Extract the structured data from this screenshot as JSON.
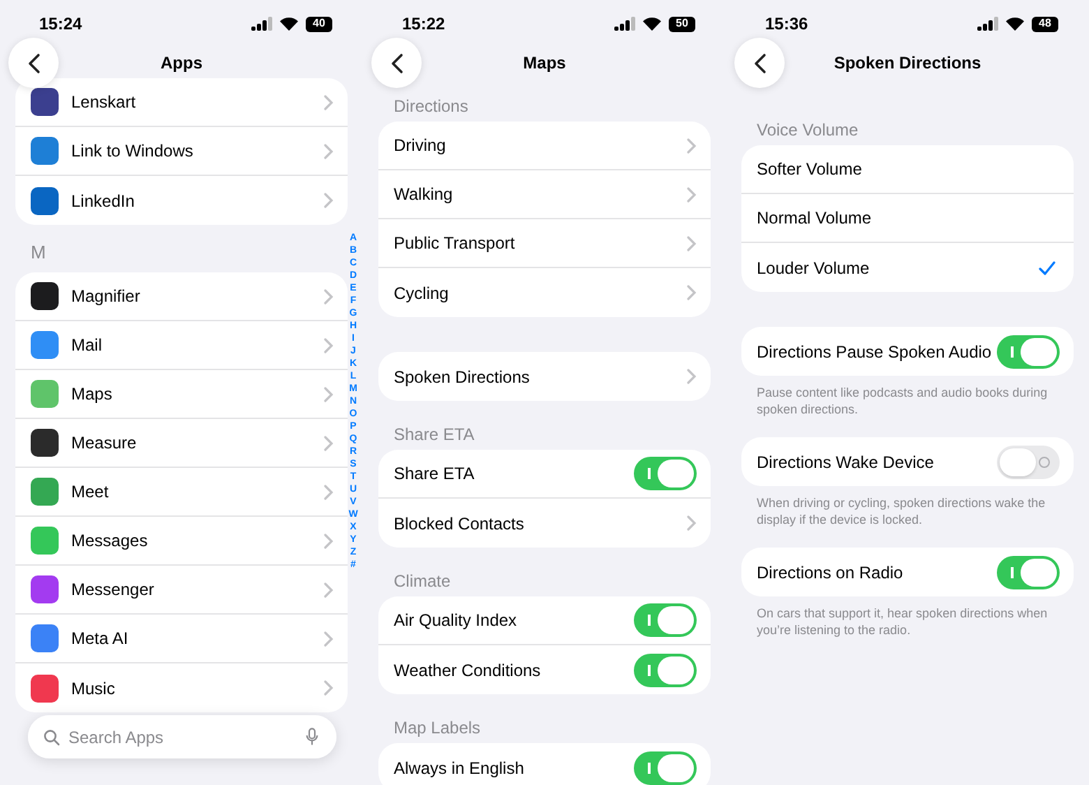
{
  "screens": [
    {
      "kind": "apps",
      "status": {
        "time": "15:24",
        "battery": "40"
      },
      "title": "Apps",
      "sections": [
        {
          "rows": [
            {
              "kind": "link",
              "label": "Lenskart",
              "color": "#3b3f8f"
            },
            {
              "kind": "link",
              "label": "Link to Windows",
              "color": "#1e7fd6"
            },
            {
              "kind": "link",
              "label": "LinkedIn",
              "color": "#0a66c2"
            }
          ]
        },
        {
          "header": "M",
          "rows": [
            {
              "kind": "link",
              "label": "Magnifier",
              "color": "#1c1c1e"
            },
            {
              "kind": "link",
              "label": "Mail",
              "color": "#2f8ef5"
            },
            {
              "kind": "link",
              "label": "Maps",
              "color": "#5fc46a"
            },
            {
              "kind": "link",
              "label": "Measure",
              "color": "#2b2b2b"
            },
            {
              "kind": "link",
              "label": "Meet",
              "color": "#34a853"
            },
            {
              "kind": "link",
              "label": "Messages",
              "color": "#34c759"
            },
            {
              "kind": "link",
              "label": "Messenger",
              "color": "#a33bf0"
            },
            {
              "kind": "link",
              "label": "Meta AI",
              "color": "#3b82f6"
            },
            {
              "kind": "link",
              "label": "Music",
              "color": "#f0384f"
            }
          ]
        }
      ],
      "index_letters": [
        "A",
        "B",
        "C",
        "D",
        "E",
        "F",
        "G",
        "H",
        "I",
        "J",
        "K",
        "L",
        "M",
        "N",
        "O",
        "P",
        "Q",
        "R",
        "S",
        "T",
        "U",
        "V",
        "W",
        "X",
        "Y",
        "Z",
        "#"
      ],
      "search": {
        "placeholder": "Search Apps"
      }
    },
    {
      "kind": "settings",
      "status": {
        "time": "15:22",
        "battery": "50"
      },
      "title": "Maps",
      "sections": [
        {
          "header": "Directions",
          "rows": [
            {
              "kind": "link",
              "label": "Driving"
            },
            {
              "kind": "link",
              "label": "Walking"
            },
            {
              "kind": "link",
              "label": "Public Transport"
            },
            {
              "kind": "link",
              "label": "Cycling"
            }
          ]
        },
        {
          "rows": [
            {
              "kind": "link",
              "label": "Spoken Directions"
            }
          ]
        },
        {
          "header": "Share ETA",
          "rows": [
            {
              "kind": "toggle",
              "label": "Share ETA",
              "on": true
            },
            {
              "kind": "link",
              "label": "Blocked Contacts"
            }
          ]
        },
        {
          "header": "Climate",
          "rows": [
            {
              "kind": "toggle",
              "label": "Air Quality Index",
              "on": true
            },
            {
              "kind": "toggle",
              "label": "Weather Conditions",
              "on": true
            }
          ]
        },
        {
          "header": "Map Labels",
          "rows": [
            {
              "kind": "toggle",
              "label": "Always in English",
              "on": true
            }
          ]
        }
      ]
    },
    {
      "kind": "settings",
      "status": {
        "time": "15:36",
        "battery": "48"
      },
      "title": "Spoken Directions",
      "sections": [
        {
          "header": "Voice Volume",
          "rows": [
            {
              "kind": "choice",
              "label": "Softer Volume",
              "selected": false
            },
            {
              "kind": "choice",
              "label": "Normal Volume",
              "selected": false
            },
            {
              "kind": "choice",
              "label": "Louder Volume",
              "selected": true
            }
          ]
        },
        {
          "rows": [
            {
              "kind": "toggle",
              "label": "Directions Pause Spoken Audio",
              "on": true
            }
          ],
          "footer": "Pause content like podcasts and audio books during spoken directions."
        },
        {
          "rows": [
            {
              "kind": "toggle",
              "label": "Directions Wake Device",
              "on": false
            }
          ],
          "footer": "When driving or cycling, spoken directions wake the display if the device is locked."
        },
        {
          "rows": [
            {
              "kind": "toggle",
              "label": "Directions on Radio",
              "on": true
            }
          ],
          "footer": "On cars that support it, hear spoken directions when you’re listening to the radio."
        }
      ]
    }
  ]
}
